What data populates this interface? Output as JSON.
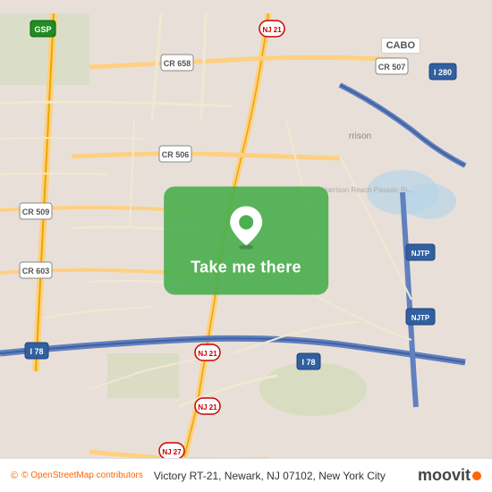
{
  "map": {
    "title": "Victory RT-21, Newark, NJ 07102, New York City",
    "attribution": "© OpenStreetMap contributors",
    "center_button": "Take me there",
    "cabo_label": "CABO",
    "background_color": "#e8e0d8"
  },
  "bottom_bar": {
    "attribution": "© OpenStreetMap contributors",
    "address": "Victory RT-21, Newark, NJ 07102, New York City",
    "logo": "moovit"
  },
  "road_labels": [
    "CR 658",
    "NJ 21",
    "CR 507",
    "GSP",
    "CR 506",
    "I 280",
    "CR 509",
    "CR 603",
    "NJTP",
    "I 78",
    "NJ 21",
    "I 78",
    "NJ 27"
  ],
  "icons": {
    "map_pin": "📍",
    "osm_icon": "©"
  }
}
